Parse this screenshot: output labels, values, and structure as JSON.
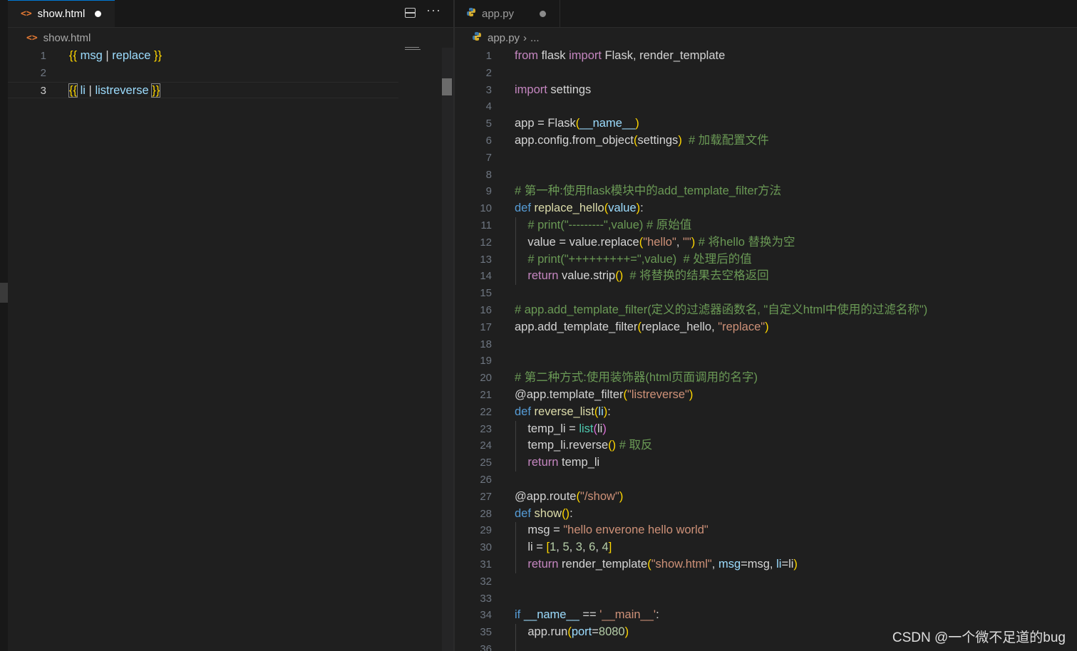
{
  "left_editor": {
    "tab_title": "show.html",
    "breadcrumb": "show.html",
    "lines": [
      {
        "n": "1",
        "segs": [
          [
            "br1",
            "{{"
          ],
          [
            "op",
            " "
          ],
          [
            "var",
            "msg"
          ],
          [
            "op",
            " | "
          ],
          [
            "var",
            "replace"
          ],
          [
            "op",
            " "
          ],
          [
            "br1",
            "}}"
          ]
        ]
      },
      {
        "n": "2",
        "segs": []
      },
      {
        "n": "3",
        "segs": [
          [
            "br1",
            "{{"
          ],
          [
            "op",
            " "
          ],
          [
            "var",
            "li"
          ],
          [
            "op",
            " | "
          ],
          [
            "var",
            "listreverse"
          ],
          [
            "op",
            " "
          ],
          [
            "br1",
            "}}"
          ]
        ]
      }
    ]
  },
  "right_editor": {
    "tab_title": "app.py",
    "breadcrumb_file": "app.py",
    "breadcrumb_more": "...",
    "lines": [
      {
        "n": "1",
        "segs": [
          [
            "kw",
            "from"
          ],
          [
            "op",
            " flask "
          ],
          [
            "kw",
            "import"
          ],
          [
            "op",
            " Flask, render_template"
          ]
        ]
      },
      {
        "n": "2",
        "segs": []
      },
      {
        "n": "3",
        "segs": [
          [
            "kw",
            "import"
          ],
          [
            "op",
            " settings"
          ]
        ]
      },
      {
        "n": "4",
        "segs": []
      },
      {
        "n": "5",
        "segs": [
          [
            "op",
            "app = Flask"
          ],
          [
            "br1",
            "("
          ],
          [
            "var",
            "__name__"
          ],
          [
            "br1",
            ")"
          ]
        ]
      },
      {
        "n": "6",
        "segs": [
          [
            "op",
            "app.config.from_object"
          ],
          [
            "br1",
            "("
          ],
          [
            "op",
            "settings"
          ],
          [
            "br1",
            ")"
          ],
          [
            "op",
            "  "
          ],
          [
            "cm",
            "# 加载配置文件"
          ]
        ]
      },
      {
        "n": "7",
        "segs": []
      },
      {
        "n": "8",
        "segs": []
      },
      {
        "n": "9",
        "segs": [
          [
            "cm",
            "# 第一种:使用flask模块中的add_template_filter方法"
          ]
        ]
      },
      {
        "n": "10",
        "segs": [
          [
            "kb",
            "def"
          ],
          [
            "op",
            " "
          ],
          [
            "fn",
            "replace_hello"
          ],
          [
            "br1",
            "("
          ],
          [
            "var",
            "value"
          ],
          [
            "br1",
            ")"
          ],
          [
            "op",
            ":"
          ]
        ]
      },
      {
        "n": "11",
        "segs": [
          [
            "op",
            "    "
          ],
          [
            "cm",
            "# print(\"---------\",value) # 原始值"
          ]
        ]
      },
      {
        "n": "12",
        "segs": [
          [
            "op",
            "    value = value.replace"
          ],
          [
            "br1",
            "("
          ],
          [
            "str",
            "\"hello\""
          ],
          [
            "op",
            ", "
          ],
          [
            "str",
            "\"\""
          ],
          [
            "br1",
            ")"
          ],
          [
            "op",
            " "
          ],
          [
            "cm",
            "# 将hello 替换为空"
          ]
        ]
      },
      {
        "n": "13",
        "segs": [
          [
            "op",
            "    "
          ],
          [
            "cm",
            "# print(\"+++++++++=\",value)  # 处理后的值"
          ]
        ]
      },
      {
        "n": "14",
        "segs": [
          [
            "op",
            "    "
          ],
          [
            "kw",
            "return"
          ],
          [
            "op",
            " value.strip"
          ],
          [
            "br1",
            "()"
          ],
          [
            "op",
            "  "
          ],
          [
            "cm",
            "# 将替换的结果去空格返回"
          ]
        ]
      },
      {
        "n": "15",
        "segs": []
      },
      {
        "n": "16",
        "segs": [
          [
            "cm",
            "# app.add_template_filter(定义的过滤器函数名, \"自定义html中使用的过滤名称\")"
          ]
        ]
      },
      {
        "n": "17",
        "segs": [
          [
            "op",
            "app.add_template_filter"
          ],
          [
            "br1",
            "("
          ],
          [
            "op",
            "replace_hello, "
          ],
          [
            "str",
            "\"replace\""
          ],
          [
            "br1",
            ")"
          ]
        ]
      },
      {
        "n": "18",
        "segs": []
      },
      {
        "n": "19",
        "segs": []
      },
      {
        "n": "20",
        "segs": [
          [
            "cm",
            "# 第二种方式:使用装饰器(html页面调用的名字)"
          ]
        ]
      },
      {
        "n": "21",
        "segs": [
          [
            "op",
            "@app.template_filter"
          ],
          [
            "br1",
            "("
          ],
          [
            "str",
            "\"listreverse\""
          ],
          [
            "br1",
            ")"
          ]
        ]
      },
      {
        "n": "22",
        "segs": [
          [
            "kb",
            "def"
          ],
          [
            "op",
            " "
          ],
          [
            "fn",
            "reverse_list"
          ],
          [
            "br1",
            "("
          ],
          [
            "var",
            "li"
          ],
          [
            "br1",
            ")"
          ],
          [
            "op",
            ":"
          ]
        ]
      },
      {
        "n": "23",
        "segs": [
          [
            "op",
            "    temp_li = "
          ],
          [
            "bt",
            "list"
          ],
          [
            "br2",
            "("
          ],
          [
            "op",
            "li"
          ],
          [
            "br2",
            ")"
          ]
        ]
      },
      {
        "n": "24",
        "segs": [
          [
            "op",
            "    temp_li.reverse"
          ],
          [
            "br1",
            "()"
          ],
          [
            "op",
            " "
          ],
          [
            "cm",
            "# 取反"
          ]
        ]
      },
      {
        "n": "25",
        "segs": [
          [
            "op",
            "    "
          ],
          [
            "kw",
            "return"
          ],
          [
            "op",
            " temp_li"
          ]
        ]
      },
      {
        "n": "26",
        "segs": []
      },
      {
        "n": "27",
        "segs": [
          [
            "op",
            "@app.route"
          ],
          [
            "br1",
            "("
          ],
          [
            "str",
            "\"/show\""
          ],
          [
            "br1",
            ")"
          ]
        ]
      },
      {
        "n": "28",
        "segs": [
          [
            "kb",
            "def"
          ],
          [
            "op",
            " "
          ],
          [
            "fn",
            "show"
          ],
          [
            "br1",
            "()"
          ],
          [
            "op",
            ":"
          ]
        ]
      },
      {
        "n": "29",
        "segs": [
          [
            "op",
            "    msg = "
          ],
          [
            "str",
            "\"hello enverone hello world\""
          ]
        ]
      },
      {
        "n": "30",
        "segs": [
          [
            "op",
            "    li = "
          ],
          [
            "br1",
            "["
          ],
          [
            "num",
            "1"
          ],
          [
            "op",
            ", "
          ],
          [
            "num",
            "5"
          ],
          [
            "op",
            ", "
          ],
          [
            "num",
            "3"
          ],
          [
            "op",
            ", "
          ],
          [
            "num",
            "6"
          ],
          [
            "op",
            ", "
          ],
          [
            "num",
            "4"
          ],
          [
            "br1",
            "]"
          ]
        ]
      },
      {
        "n": "31",
        "segs": [
          [
            "op",
            "    "
          ],
          [
            "kw",
            "return"
          ],
          [
            "op",
            " render_template"
          ],
          [
            "br1",
            "("
          ],
          [
            "str",
            "\"show.html\""
          ],
          [
            "op",
            ", "
          ],
          [
            "var",
            "msg"
          ],
          [
            "op",
            "=msg, "
          ],
          [
            "var",
            "li"
          ],
          [
            "op",
            "=li"
          ],
          [
            "br1",
            ")"
          ]
        ]
      },
      {
        "n": "32",
        "segs": []
      },
      {
        "n": "33",
        "segs": []
      },
      {
        "n": "34",
        "segs": [
          [
            "kb",
            "if"
          ],
          [
            "op",
            " "
          ],
          [
            "var",
            "__name__"
          ],
          [
            "op",
            " == "
          ],
          [
            "str",
            "'__main__'"
          ],
          [
            "op",
            ":"
          ]
        ]
      },
      {
        "n": "35",
        "segs": [
          [
            "op",
            "    app.run"
          ],
          [
            "br1",
            "("
          ],
          [
            "var",
            "port"
          ],
          [
            "op",
            "="
          ],
          [
            "num",
            "8080"
          ],
          [
            "br1",
            ")"
          ]
        ]
      },
      {
        "n": "36",
        "segs": []
      }
    ]
  },
  "watermark": "CSDN @一个微不足道的bug"
}
